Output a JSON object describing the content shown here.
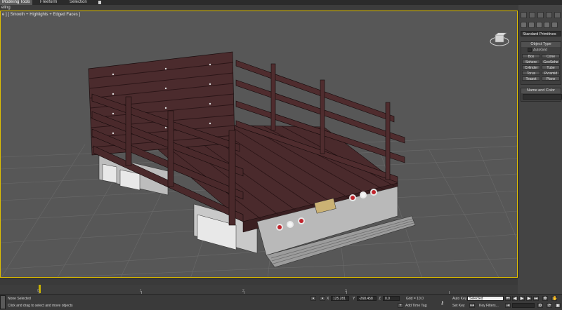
{
  "ribbon": {
    "tabs": [
      {
        "label": "Modeling Tools",
        "active": true
      },
      {
        "label": "Freeform",
        "active": false
      },
      {
        "label": "Selection",
        "active": false
      }
    ],
    "panel_text": "eling"
  },
  "viewport": {
    "label": "e ] [ Smooth + Highlights + Edged Faces ]",
    "border_color": "#e0c000"
  },
  "command_panel": {
    "category": "Standard Primitives",
    "object_type": {
      "title": "Object Type",
      "autogrid_label": "AutoGrid",
      "buttons": [
        "Box",
        "Cone",
        "Sphere",
        "GeoSphe",
        "Cylinder",
        "Tube",
        "Torus",
        "Pyramid",
        "Teapot",
        "Plane"
      ]
    },
    "name_and_color": {
      "title": "Name and Color"
    }
  },
  "timeline": {
    "labels": [
      "0",
      "1",
      "2",
      "3"
    ],
    "key_marker_color": "#c9b300"
  },
  "status": {
    "selection": "None Selected",
    "prompt": "Click and drag to select and move objects",
    "x_label": "X",
    "x_value": "125.281",
    "y_label": "Y",
    "y_value": "-268.458",
    "z_label": "Z",
    "z_value": "0.0",
    "grid": "Grid = 10.0",
    "add_time_tag": "Add Time Tag",
    "auto_key": "Auto Key",
    "auto_key_value": "Selected",
    "set_key": "Set Key",
    "key_filters": "Key Filters..."
  }
}
